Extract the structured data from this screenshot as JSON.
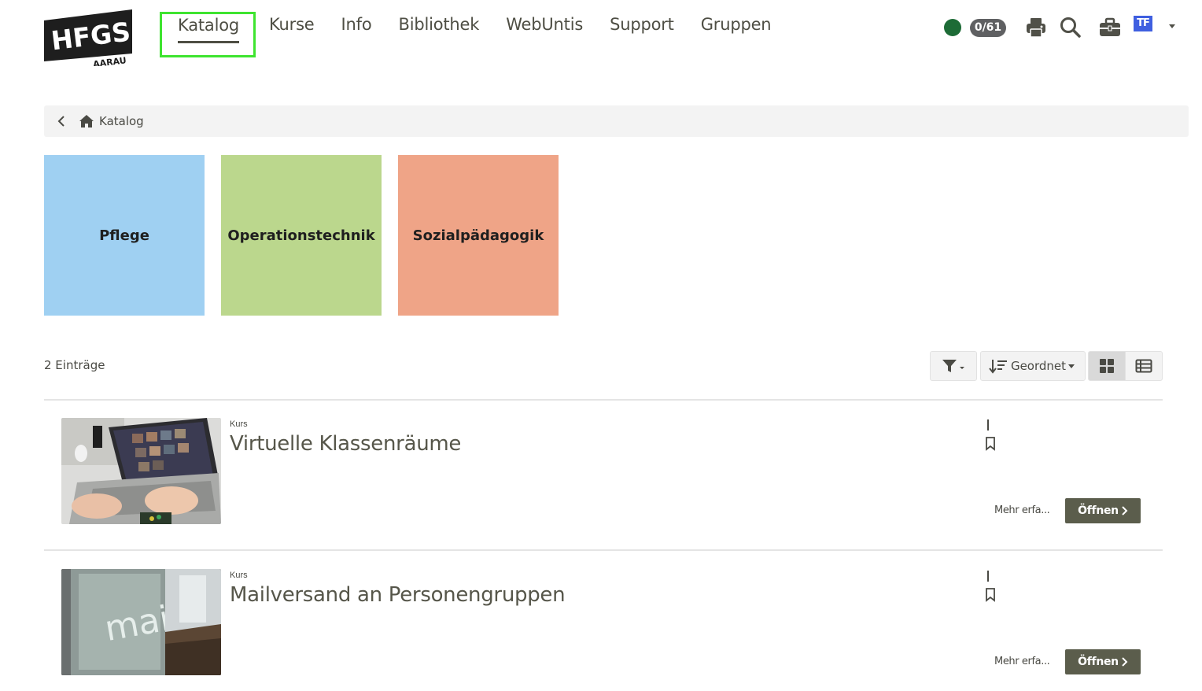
{
  "logo": {
    "name": "HFGS",
    "sub": "AARAU"
  },
  "nav": [
    "Katalog",
    "Kurse",
    "Info",
    "Bibliothek",
    "WebUntis",
    "Support",
    "Gruppen"
  ],
  "header": {
    "status_color": "#1d6b36",
    "badge": "0/61",
    "icons": [
      "print-icon",
      "search-icon",
      "briefcase-icon"
    ],
    "avatar_initials": "TF",
    "avatar_color": "#3f5fe0"
  },
  "breadcrumb": {
    "label": "Katalog"
  },
  "categories": [
    {
      "label": "Pflege",
      "color": "#9fd0f2"
    },
    {
      "label": "Operationstechnik",
      "color": "#bbd78d"
    },
    {
      "label": "Sozialpädagogik",
      "color": "#efa487"
    }
  ],
  "toolbar": {
    "count": "2 Einträge",
    "sort_label": "Geordnet",
    "view_mode": "grid"
  },
  "entries": [
    {
      "type": "Kurs",
      "title": "Virtuelle Klassenräume",
      "more": "Mehr erfa...",
      "open": "Öffnen"
    },
    {
      "type": "Kurs",
      "title": "Mailversand an Personengruppen",
      "more": "Mehr erfa...",
      "open": "Öffnen",
      "thumb_text": "mail"
    }
  ],
  "colors": {
    "accent": "#5b5d4c",
    "highlight": "#3ee42f"
  }
}
